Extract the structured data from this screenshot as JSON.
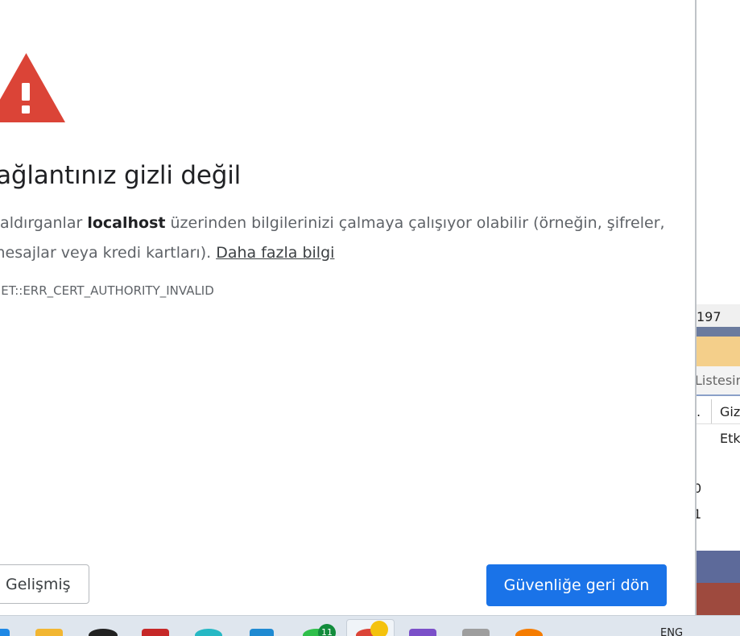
{
  "interstitial": {
    "title": "Bağlantınız gizli değil",
    "body_prefix": "Saldırganlar ",
    "body_host": "localhost",
    "body_middle": " üzerinden bilgilerinizi çalmaya çalışıyor olabilir (örneğin, şifreler,",
    "body_line2": "mesajlar veya kredi kartları). ",
    "learn_more_link": "Daha fazla bilgi",
    "error_code": "NET::ERR_CERT_AUTHORITY_INVALID",
    "advanced_button": "Gelişmiş",
    "back_to_safety_button": "Güvenliğe geri dön",
    "icon": "warning-triangle-icon",
    "colors": {
      "warning_red": "#db4437",
      "primary_blue": "#1a73e8"
    }
  },
  "background_window": {
    "number": "197",
    "tab_label": "Listesin",
    "col_header_1": ".",
    "col_header_2": "Giz",
    "cell_value": "Etk",
    "row_value_1": "0",
    "row_value_2": "1"
  },
  "taskbar": {
    "language": "ENG",
    "badge_count": "11"
  }
}
